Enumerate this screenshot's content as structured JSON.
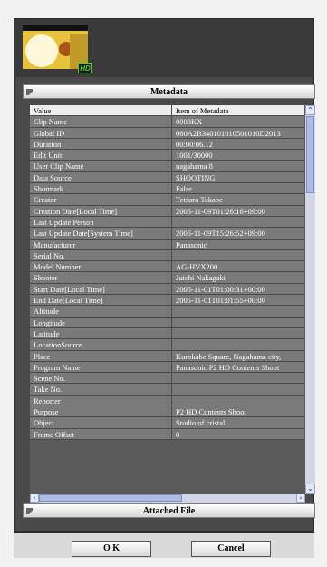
{
  "thumbnail": {
    "badge": "HD"
  },
  "metadata": {
    "header": "Metadata",
    "columns": [
      "Value",
      "Item of Metadata"
    ],
    "rows": [
      [
        "Clip Name",
        "0008KX"
      ],
      [
        "Global ID",
        "060A2B340101010501010D2013"
      ],
      [
        "Duration",
        "00:00:06.12"
      ],
      [
        "Edit Unit",
        "1001/30000"
      ],
      [
        "User Clip Name",
        "nagahama 8"
      ],
      [
        "Data Source",
        "SHOOTING"
      ],
      [
        "Shotmark",
        "False"
      ],
      [
        "Creator",
        "Tetsuro Takabe"
      ],
      [
        "Creation Date[Local Time]",
        "2005-11-09T01:26:16+09:00"
      ],
      [
        "Last Update Person",
        ""
      ],
      [
        "Last Update Date[System Time]",
        "2005-11-09T15:26:52+09:00"
      ],
      [
        "Manufacturer",
        "Panasonic"
      ],
      [
        "Serial No.",
        ""
      ],
      [
        "Model Number",
        "AG-HVX200"
      ],
      [
        "Shooter",
        "Juichi Nakagaki"
      ],
      [
        "Start Date[Local Time]",
        "2005-11-01T01:00:31+00:00"
      ],
      [
        "End Date[Local Time]",
        "2005-11-01T01:01:55+00:00"
      ],
      [
        "Altitude",
        ""
      ],
      [
        "Longitude",
        ""
      ],
      [
        "Latitude",
        ""
      ],
      [
        "LocationSource",
        ""
      ],
      [
        "Place",
        "Kurokabe Square, Nagahama city,"
      ],
      [
        "Program Name",
        "Panasonic P2 HD Contents Shoot"
      ],
      [
        "Scene No.",
        ""
      ],
      [
        "Take No.",
        ""
      ],
      [
        "Reporter",
        ""
      ],
      [
        "Purpose",
        "P2 HD Contents Shoot"
      ],
      [
        "Object",
        "Studio of cristal"
      ],
      [
        "Frame Offset",
        "0"
      ]
    ]
  },
  "attached": {
    "header": "Attached File"
  },
  "buttons": {
    "ok": "O K",
    "cancel": "Cancel"
  }
}
